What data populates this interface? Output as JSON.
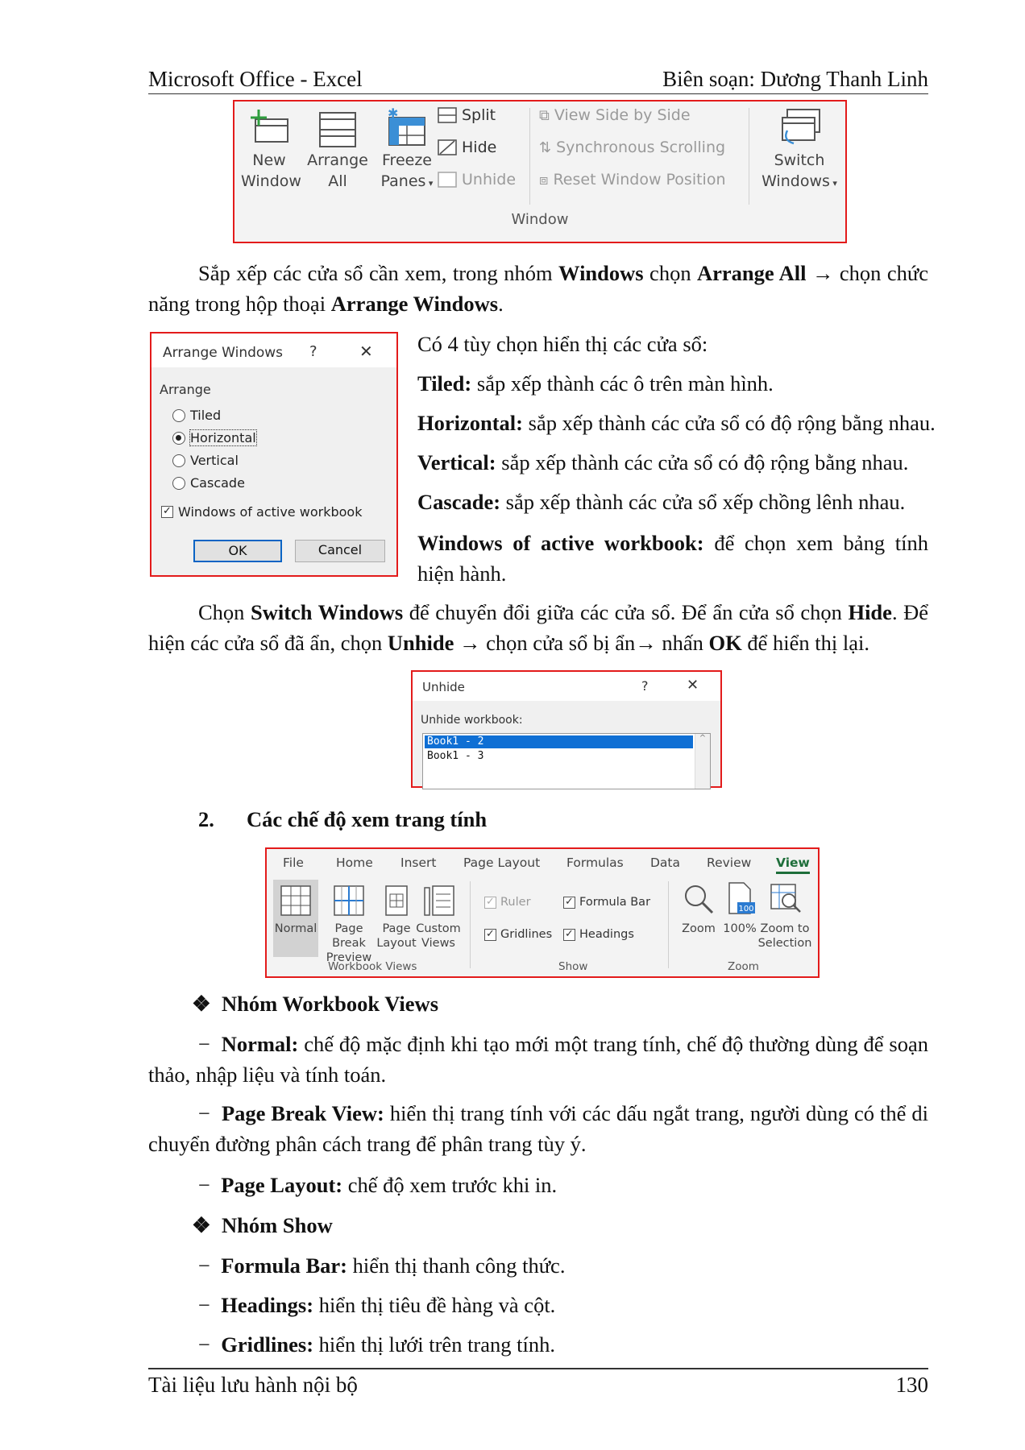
{
  "header": {
    "left": "Microsoft Office - Excel",
    "right": "Biên soạn: Dương Thanh Linh"
  },
  "window_ribbon": {
    "new_window": [
      "New",
      "Window"
    ],
    "arrange_all": [
      "Arrange",
      "All"
    ],
    "freeze_panes": [
      "Freeze",
      "Panes"
    ],
    "split": "Split",
    "hide": "Hide",
    "unhide": "Unhide",
    "view_side_by_side": "View Side by Side",
    "synchronous_scrolling": "Synchronous Scrolling",
    "reset_window_position": "Reset Window Position",
    "switch_windows": [
      "Switch",
      "Windows"
    ],
    "group_label": "Window"
  },
  "para1": {
    "t1": "Sắp xếp các cửa sổ cần xem, trong nhóm ",
    "b1": "Windows",
    "t2": " chọn ",
    "b2": "Arrange All",
    "t3": " → chọn chức năng trong hộp thoại ",
    "b3": "Arrange Windows",
    "t4": "."
  },
  "arrange_dialog": {
    "title": "Arrange Windows",
    "help": "?",
    "close": "✕",
    "section": "Arrange",
    "options": [
      "Tiled",
      "Horizontal",
      "Vertical",
      "Cascade"
    ],
    "selected_index": 1,
    "checkbox_label": "Windows of active workbook",
    "checkbox_checked": true,
    "ok": "OK",
    "cancel": "Cancel"
  },
  "options_intro": "Có 4 tùy chọn hiển thị các cửa sổ:",
  "options": [
    {
      "term": "Tiled:",
      "desc": " sắp xếp thành các ô trên màn hình."
    },
    {
      "term": "Horizontal:",
      "desc": " sắp xếp thành các cửa sổ có độ rộng bằng nhau."
    },
    {
      "term": "Vertical:",
      "desc": " sắp xếp thành các cửa sổ có độ rộng bằng nhau."
    },
    {
      "term": "Cascade:",
      "desc": " sắp xếp thành các cửa sổ xếp chồng lênh nhau."
    },
    {
      "term": "Windows of active workbook:",
      "desc": " để chọn xem bảng tính hiện hành."
    }
  ],
  "para2": {
    "t1": "Chọn ",
    "b1": "Switch Windows",
    "t2": " để chuyển đổi giữa các cửa sổ. Để ẩn cửa sổ chọn ",
    "b2": "Hide",
    "t3": ". Để hiện các cửa sổ đã ẩn, chọn ",
    "b3": "Unhide",
    "t4": " → chọn cửa sổ bị ẩn→ nhấn ",
    "b4": "OK",
    "t5": " để hiển thị lại."
  },
  "unhide_dialog": {
    "title": "Unhide",
    "help": "?",
    "close": "✕",
    "label": "Unhide workbook:",
    "items": [
      "Book1 - 2",
      "Book1 - 3"
    ],
    "selected_index": 0
  },
  "section2": {
    "num": "2.",
    "title": "Các chế độ xem trang tính"
  },
  "view_ribbon": {
    "tabs": [
      "File",
      "Home",
      "Insert",
      "Page Layout",
      "Formulas",
      "Data",
      "Review",
      "View"
    ],
    "active_tab": "View",
    "normal": "Normal",
    "page_break": [
      "Page Break",
      "Preview"
    ],
    "page_layout": [
      "Page",
      "Layout"
    ],
    "custom_views": [
      "Custom",
      "Views"
    ],
    "ruler": "Ruler",
    "formula_bar": "Formula Bar",
    "gridlines": "Gridlines",
    "headings": "Headings",
    "zoom": "Zoom",
    "zoom100": "100%",
    "zoom100_icon_text": "100",
    "zoom_selection": [
      "Zoom to",
      "Selection"
    ],
    "group_workbook_views": "Workbook Views",
    "group_show": "Show",
    "group_zoom": "Zoom",
    "ruler_checked": true,
    "formula_bar_checked": true,
    "gridlines_checked": true,
    "headings_checked": true
  },
  "group_wb_heading": "Nhóm Workbook Views",
  "wb_items": [
    {
      "term": "Normal:",
      "desc": " chế độ mặc định khi tạo mới một trang tính, chế độ thường dùng để soạn thảo, nhập liệu và tính toán."
    },
    {
      "term": "Page Break View:",
      "desc": " hiển thị trang tính với các dấu ngắt trang, người dùng có thể di chuyển đường phân cách trang để phân trang tùy ý."
    },
    {
      "term": "Page Layout:",
      "desc": " chế độ xem trước khi in."
    }
  ],
  "group_show_heading": "Nhóm Show",
  "show_items": [
    {
      "term": "Formula Bar:",
      "desc": " hiển thị thanh công thức."
    },
    {
      "term": "Headings:",
      "desc": " hiển thị tiêu đề hàng và cột."
    },
    {
      "term": "Gridlines:",
      "desc": " hiển thị lưới trên trang tính."
    }
  ],
  "dash": "−",
  "bullet": "❖",
  "footer": {
    "left": "Tài liệu lưu hành nội bộ",
    "right": "130"
  }
}
